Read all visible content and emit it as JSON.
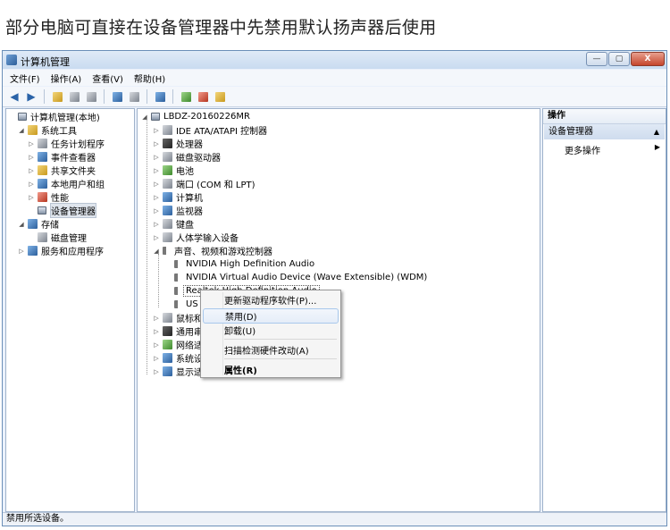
{
  "caption": "部分电脑可直接在设备管理器中先禁用默认扬声器后使用",
  "window": {
    "title": "计算机管理",
    "controls": [
      "—",
      "▢",
      "X"
    ]
  },
  "menubar": [
    "文件(F)",
    "操作(A)",
    "查看(V)",
    "帮助(H)"
  ],
  "toolbar_icons": [
    "back-icon",
    "forward-icon",
    "up-folder-icon",
    "show-hide-tree-icon",
    "export-icon",
    "help-icon",
    "properties-icon",
    "scan-icon",
    "update-driver-icon",
    "disable-icon",
    "uninstall-icon"
  ],
  "left_tree": [
    {
      "label": "计算机管理(本地)",
      "level": 0,
      "expander": "",
      "icon": "computer"
    },
    {
      "label": "系统工具",
      "level": 1,
      "expander": "◢",
      "icon": "yellow"
    },
    {
      "label": "任务计划程序",
      "level": 2,
      "expander": "▷",
      "icon": "gray"
    },
    {
      "label": "事件查看器",
      "level": 2,
      "expander": "▷",
      "icon": "blue"
    },
    {
      "label": "共享文件夹",
      "level": 2,
      "expander": "▷",
      "icon": "yellow"
    },
    {
      "label": "本地用户和组",
      "level": 2,
      "expander": "▷",
      "icon": "blue"
    },
    {
      "label": "性能",
      "level": 2,
      "expander": "▷",
      "icon": "red"
    },
    {
      "label": "设备管理器",
      "level": 2,
      "expander": "",
      "icon": "computer",
      "selected": true
    },
    {
      "label": "存储",
      "level": 1,
      "expander": "◢",
      "icon": "blue"
    },
    {
      "label": "磁盘管理",
      "level": 2,
      "expander": "",
      "icon": "gray"
    },
    {
      "label": "服务和应用程序",
      "level": 1,
      "expander": "▷",
      "icon": "blue"
    }
  ],
  "device_tree": [
    {
      "label": "LBDZ-20160226MR",
      "level": 0,
      "expander": "◢",
      "icon": "computer"
    },
    {
      "label": "IDE ATA/ATAPI 控制器",
      "level": 1,
      "expander": "▷",
      "icon": "gray"
    },
    {
      "label": "处理器",
      "level": 1,
      "expander": "▷",
      "icon": "dark"
    },
    {
      "label": "磁盘驱动器",
      "level": 1,
      "expander": "▷",
      "icon": "gray"
    },
    {
      "label": "电池",
      "level": 1,
      "expander": "▷",
      "icon": "green"
    },
    {
      "label": "端口 (COM 和 LPT)",
      "level": 1,
      "expander": "▷",
      "icon": "gray"
    },
    {
      "label": "计算机",
      "level": 1,
      "expander": "▷",
      "icon": "blue"
    },
    {
      "label": "监视器",
      "level": 1,
      "expander": "▷",
      "icon": "blue"
    },
    {
      "label": "键盘",
      "level": 1,
      "expander": "▷",
      "icon": "gray"
    },
    {
      "label": "人体学输入设备",
      "level": 1,
      "expander": "▷",
      "icon": "gray"
    },
    {
      "label": "声音、视频和游戏控制器",
      "level": 1,
      "expander": "◢",
      "icon": "speaker"
    },
    {
      "label": "NVIDIA High Definition Audio",
      "level": 2,
      "expander": "",
      "icon": "speaker"
    },
    {
      "label": "NVIDIA Virtual Audio Device (Wave Extensible) (WDM)",
      "level": 2,
      "expander": "",
      "icon": "speaker"
    },
    {
      "label": "Realtek High Definition Audio",
      "level": 2,
      "expander": "",
      "icon": "speaker",
      "selected": true
    },
    {
      "label": "US",
      "level": 2,
      "expander": "",
      "icon": "speaker"
    },
    {
      "label": "鼠标和",
      "level": 1,
      "expander": "▷",
      "icon": "gray"
    },
    {
      "label": "通用串",
      "level": 1,
      "expander": "▷",
      "icon": "dark"
    },
    {
      "label": "网络适",
      "level": 1,
      "expander": "▷",
      "icon": "green"
    },
    {
      "label": "系统设",
      "level": 1,
      "expander": "▷",
      "icon": "blue"
    },
    {
      "label": "显示适",
      "level": 1,
      "expander": "▷",
      "icon": "blue"
    }
  ],
  "context_menu": [
    {
      "label": "更新驱动程序软件(P)...",
      "highlighted": false,
      "bold": false
    },
    {
      "label": "禁用(D)",
      "highlighted": true,
      "bold": false
    },
    {
      "label": "卸载(U)",
      "highlighted": false,
      "bold": false
    },
    {
      "label": "扫描检测硬件改动(A)",
      "highlighted": false,
      "bold": false
    },
    {
      "label": "属性(R)",
      "highlighted": false,
      "bold": true
    }
  ],
  "actions": {
    "header": "操作",
    "section": "设备管理器",
    "section_arrow": "▲",
    "more": "更多操作",
    "more_arrow": "▶"
  },
  "status": "禁用所选设备。"
}
